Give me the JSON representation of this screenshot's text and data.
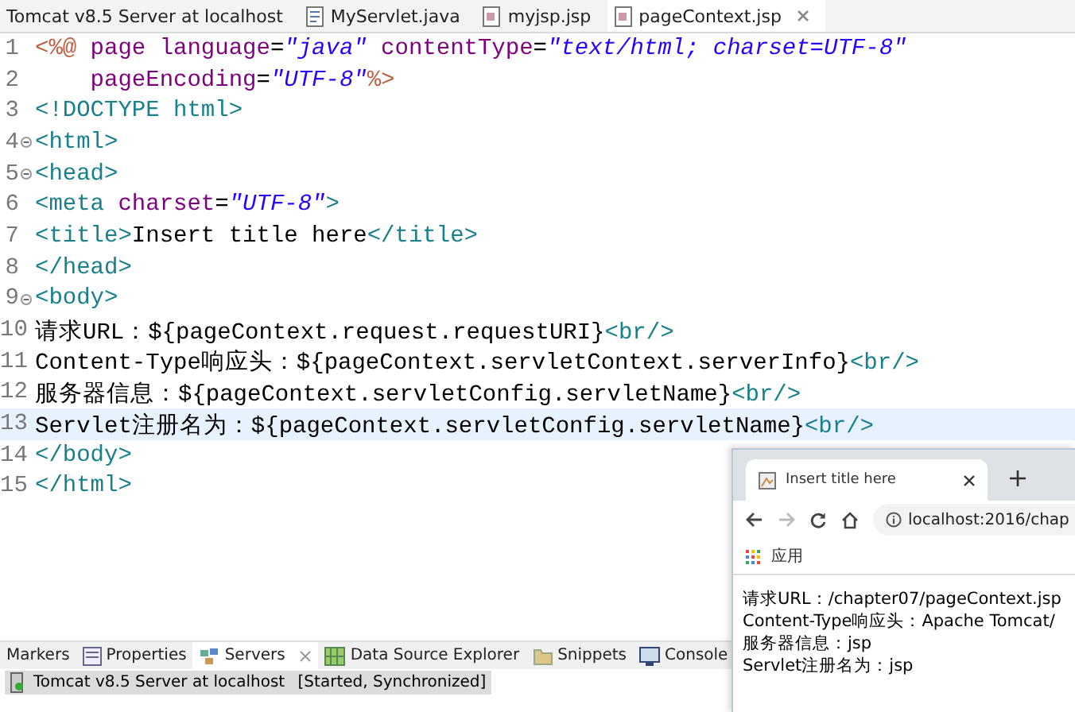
{
  "editor_tabs": [
    {
      "label": "Tomcat v8.5 Server at localhost",
      "kind": "server",
      "selected": false
    },
    {
      "label": "MyServlet.java",
      "kind": "java",
      "selected": false
    },
    {
      "label": "myjsp.jsp",
      "kind": "jsp",
      "selected": false
    },
    {
      "label": "pageContext.jsp",
      "kind": "jsp",
      "selected": true
    }
  ],
  "code_lines": [
    {
      "number": "1",
      "fold": false,
      "current": false,
      "tokens": [
        {
          "kind": "directive",
          "text": "<%@"
        },
        {
          "kind": "attr",
          "text": " page language"
        },
        {
          "kind": "plain",
          "text": "="
        },
        {
          "kind": "str",
          "text": "\"java\""
        },
        {
          "kind": "attr",
          "text": " contentType"
        },
        {
          "kind": "plain",
          "text": "="
        },
        {
          "kind": "str",
          "text": "\"text/html; charset=UTF-8\""
        }
      ]
    },
    {
      "number": "2",
      "fold": false,
      "current": false,
      "tokens": [
        {
          "kind": "attr",
          "text": "    pageEncoding"
        },
        {
          "kind": "plain",
          "text": "="
        },
        {
          "kind": "str",
          "text": "\"UTF-8\""
        },
        {
          "kind": "directive",
          "text": "%>"
        }
      ]
    },
    {
      "number": "3",
      "fold": false,
      "current": false,
      "tokens": [
        {
          "kind": "tag",
          "text": "<!DOCTYPE html>"
        }
      ]
    },
    {
      "number": "4",
      "fold": true,
      "current": false,
      "tokens": [
        {
          "kind": "tag",
          "text": "<html>"
        }
      ]
    },
    {
      "number": "5",
      "fold": true,
      "current": false,
      "tokens": [
        {
          "kind": "tag",
          "text": "<head>"
        }
      ]
    },
    {
      "number": "6",
      "fold": false,
      "current": false,
      "tokens": [
        {
          "kind": "tag",
          "text": "<meta"
        },
        {
          "kind": "attr",
          "text": " charset"
        },
        {
          "kind": "plain",
          "text": "="
        },
        {
          "kind": "str",
          "text": "\"UTF-8\""
        },
        {
          "kind": "tag",
          "text": ">"
        }
      ]
    },
    {
      "number": "7",
      "fold": false,
      "current": false,
      "tokens": [
        {
          "kind": "tag",
          "text": "<title>"
        },
        {
          "kind": "plain",
          "text": "Insert title here"
        },
        {
          "kind": "tag",
          "text": "</title>"
        }
      ]
    },
    {
      "number": "8",
      "fold": false,
      "current": false,
      "tokens": [
        {
          "kind": "tag",
          "text": "</head>"
        }
      ]
    },
    {
      "number": "9",
      "fold": true,
      "current": false,
      "tokens": [
        {
          "kind": "tag",
          "text": "<body>"
        }
      ]
    },
    {
      "number": "10",
      "fold": false,
      "current": false,
      "tokens": [
        {
          "kind": "plain",
          "text": "请求URL：${pageContext.request.requestURI}"
        },
        {
          "kind": "tag",
          "text": "<br/>"
        }
      ]
    },
    {
      "number": "11",
      "fold": false,
      "current": false,
      "tokens": [
        {
          "kind": "plain",
          "text": "Content-Type响应头：${pageContext.servletContext.serverInfo}"
        },
        {
          "kind": "tag",
          "text": "<br/>"
        }
      ]
    },
    {
      "number": "12",
      "fold": false,
      "current": false,
      "tokens": [
        {
          "kind": "plain",
          "text": "服务器信息：${pageContext.servletConfig.servletName}"
        },
        {
          "kind": "tag",
          "text": "<br/>"
        }
      ]
    },
    {
      "number": "13",
      "fold": false,
      "current": true,
      "tokens": [
        {
          "kind": "plain",
          "text": "Servlet注册名为：${pageContext.servletConfig.servletName}"
        },
        {
          "kind": "tag",
          "text": "<br/>"
        }
      ]
    },
    {
      "number": "14",
      "fold": false,
      "current": false,
      "tokens": [
        {
          "kind": "tag",
          "text": "</body>"
        }
      ]
    },
    {
      "number": "15",
      "fold": false,
      "current": false,
      "tokens": [
        {
          "kind": "tag",
          "text": "</html>"
        }
      ]
    }
  ],
  "bottom_tabs": [
    {
      "label": "Markers",
      "kind": "markers",
      "selected": false
    },
    {
      "label": "Properties",
      "kind": "properties",
      "selected": false
    },
    {
      "label": "Servers",
      "kind": "servers",
      "selected": true
    },
    {
      "label": "Data Source Explorer",
      "kind": "datasource",
      "selected": false
    },
    {
      "label": "Snippets",
      "kind": "snippets",
      "selected": false
    },
    {
      "label": "Console",
      "kind": "console",
      "selected": false
    }
  ],
  "server_row": {
    "name": "Tomcat v8.5 Server at localhost",
    "status": "[Started, Synchronized]"
  },
  "browser": {
    "tab_title": "Insert title here",
    "address": "localhost:2016/chap",
    "bookmark": "应用",
    "content": [
      "请求URL：/chapter07/pageContext.jsp",
      "Content-Type响应头：Apache Tomcat/",
      "服务器信息：jsp",
      "Servlet注册名为：jsp"
    ]
  }
}
